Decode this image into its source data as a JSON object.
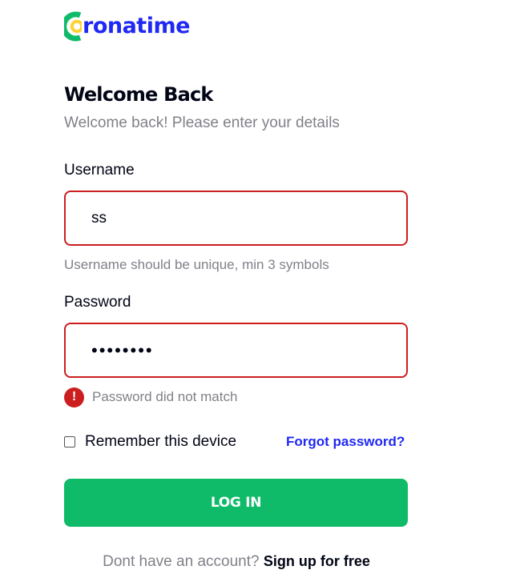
{
  "logo": {
    "text": "ronatime",
    "brand_color": "#2029f3"
  },
  "header": {
    "title": "Welcome Back",
    "subtitle": "Welcome back! Please enter your details"
  },
  "form": {
    "username": {
      "label": "Username",
      "value": "ss",
      "hint": "Username should be unique, min 3 symbols"
    },
    "password": {
      "label": "Password",
      "value": "ssssssss",
      "error": "Password did not match",
      "error_icon": "!"
    },
    "remember_label": "Remember this device",
    "remember_checked": false,
    "forgot_label": "Forgot password?",
    "submit_label": "LOG IN"
  },
  "footer": {
    "question": "Dont have an account?",
    "signup_label": "Sign up for free"
  },
  "colors": {
    "accent": "#2029f3",
    "success": "#0fba68",
    "error": "#cc1e1e",
    "muted": "#808189",
    "logo_yellow": "#ffd233"
  }
}
